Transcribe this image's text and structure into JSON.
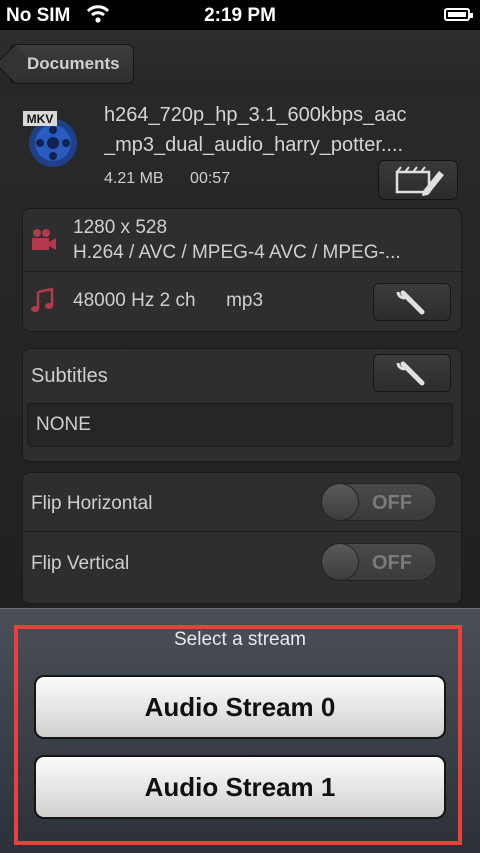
{
  "status_bar": {
    "carrier": "No SIM",
    "time": "2:19 PM"
  },
  "nav": {
    "back_label": "Documents"
  },
  "file": {
    "badge": "MKV",
    "name_line1": "h264_720p_hp_3.1_600kbps_aac",
    "name_line2": "_mp3_dual_audio_harry_potter....",
    "size": "4.21 MB",
    "duration": "00:57"
  },
  "video": {
    "resolution": "1280 x 528",
    "codec": "H.264 / AVC / MPEG-4 AVC / MPEG-..."
  },
  "audio": {
    "info": "48000 Hz 2 ch",
    "codec": "mp3"
  },
  "subtitles": {
    "title": "Subtitles",
    "value": "NONE"
  },
  "toggles": {
    "flip_horizontal": {
      "label": "Flip Horizontal",
      "state": "OFF"
    },
    "flip_vertical": {
      "label": "Flip Vertical",
      "state": "OFF"
    }
  },
  "sheet": {
    "title": "Select a stream",
    "buttons": [
      "Audio Stream 0",
      "Audio Stream 1"
    ]
  },
  "colors": {
    "highlight": "#e8403a",
    "icon_red": "#b5394a"
  }
}
